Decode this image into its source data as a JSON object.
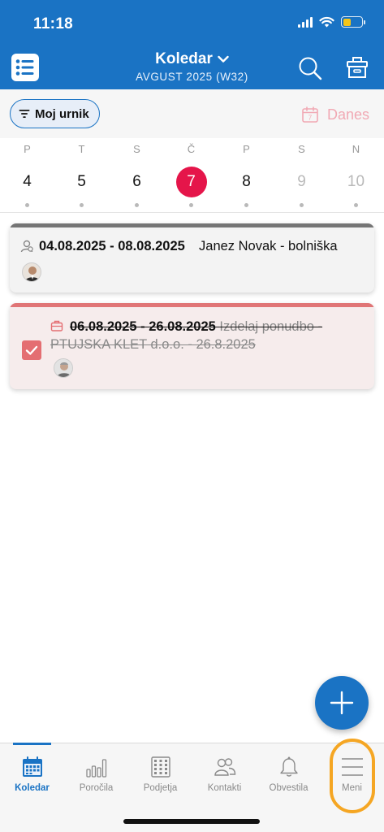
{
  "status_bar": {
    "time": "11:18"
  },
  "header": {
    "title": "Koledar",
    "subtitle": "AVGUST 2025 (W32)"
  },
  "filter": {
    "chip_label": "Moj urnik",
    "today_label": "Danes",
    "today_icon_day": "7"
  },
  "week": {
    "days": [
      {
        "letter": "P",
        "num": "4"
      },
      {
        "letter": "T",
        "num": "5"
      },
      {
        "letter": "S",
        "num": "6"
      },
      {
        "letter": "Č",
        "num": "7"
      },
      {
        "letter": "P",
        "num": "8"
      },
      {
        "letter": "S",
        "num": "9"
      },
      {
        "letter": "N",
        "num": "10"
      }
    ],
    "selected_num": "7"
  },
  "events": [
    {
      "date_range": "04.08.2025 - 08.08.2025",
      "title": "Janez Novak - bolniška",
      "icon": "absence-icon",
      "bar_color": "#757575",
      "completed": false
    },
    {
      "date_range": "06.08.2025 - 26.08.2025",
      "title": "Izdelaj ponudbo -",
      "title_line2": "PTUJSKA KLET d.o.o. - 26.8.2025",
      "icon": "briefcase-icon",
      "bar_color": "#e07576",
      "completed": true
    }
  ],
  "bottom_nav": [
    {
      "label": "Koledar",
      "icon": "calendar-icon",
      "active": true
    },
    {
      "label": "Poročila",
      "icon": "bar-chart-icon",
      "active": false
    },
    {
      "label": "Podjetja",
      "icon": "building-icon",
      "active": false
    },
    {
      "label": "Kontakti",
      "icon": "contacts-icon",
      "active": false
    },
    {
      "label": "Obvestila",
      "icon": "bell-icon",
      "active": false
    },
    {
      "label": "Meni",
      "icon": "hamburger-icon",
      "active": false
    }
  ],
  "colors": {
    "brand_blue": "#1a73c4",
    "selected_day": "#e5154a",
    "highlight_ring": "#f5a623"
  }
}
